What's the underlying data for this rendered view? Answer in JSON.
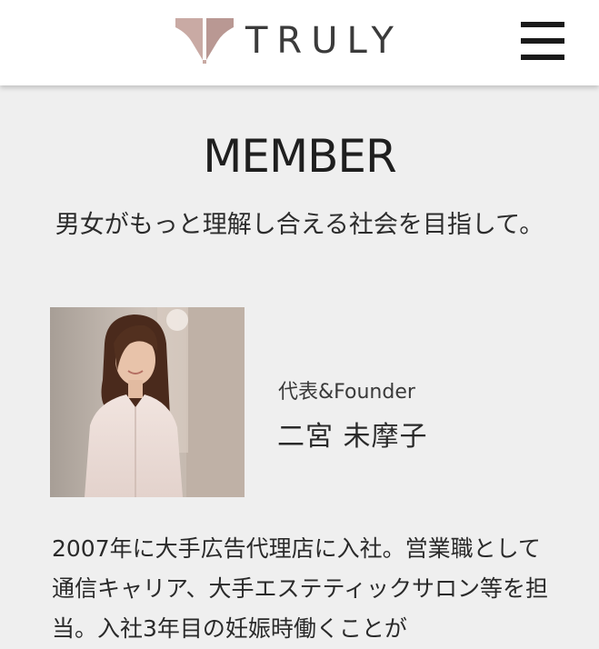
{
  "header": {
    "brand": "TRULY",
    "brand_color": "#c8aba6",
    "menu_icon": "hamburger-menu-icon"
  },
  "main": {
    "title": "MEMBER",
    "subtitle": "男女がもっと理解し合える社会を目指して。",
    "member": {
      "role": "代表&Founder",
      "name": "二宮 未摩子",
      "bio": "2007年に大手広告代理店に入社。営業職として通信キャリア、大手エステティックサロン等を担当。入社3年目の妊娠時働くことが"
    }
  }
}
